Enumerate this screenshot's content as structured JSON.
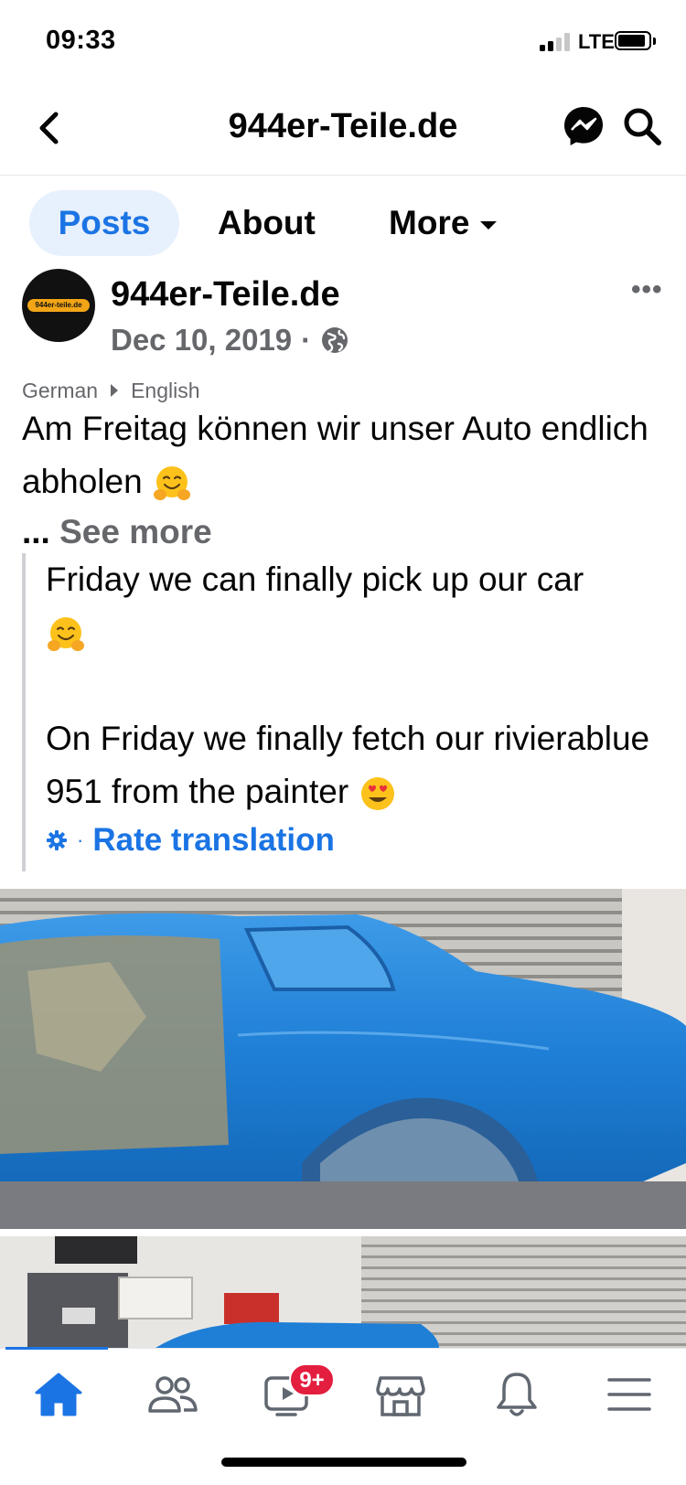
{
  "status_bar": {
    "time": "09:33",
    "network": "LTE",
    "signal_bars_active": 2,
    "signal_bars_total": 4,
    "battery_level": 0.9
  },
  "header": {
    "title": "944er-Teile.de",
    "back_icon": "chevron-left-icon",
    "messenger_icon": "messenger-icon",
    "search_icon": "search-icon"
  },
  "tabs": {
    "items": [
      {
        "label": "Posts",
        "active": true
      },
      {
        "label": "About",
        "active": false
      },
      {
        "label": "More",
        "active": false
      }
    ]
  },
  "post": {
    "author": "944er-Teile.de",
    "avatar_text": "944er-teile.de",
    "date": "Dec 10, 2019",
    "separator": "·",
    "privacy_icon": "globe-icon",
    "more_label": "•••",
    "translation_from": "German",
    "translation_to": "English",
    "original_text": "Am Freitag können wir unser Auto endlich abholen",
    "ellipsis": "...",
    "see_more": "See more",
    "translated_line1": "Friday we can finally pick up our car",
    "translated_line2": "On Friday we finally fetch our rivierablue 951 from the painter",
    "rate_separator": "·",
    "rate_translation": "Rate translation"
  },
  "bottom_nav": {
    "items": [
      "home-icon",
      "friends-icon",
      "watch-icon",
      "marketplace-icon",
      "notifications-icon",
      "menu-icon"
    ],
    "watch_badge": "9+",
    "active": "home"
  },
  "colors": {
    "accent": "#1b74e4",
    "secondary_text": "#65676b",
    "badge": "#e41e3f",
    "car_paint": "#1f7fd6"
  }
}
